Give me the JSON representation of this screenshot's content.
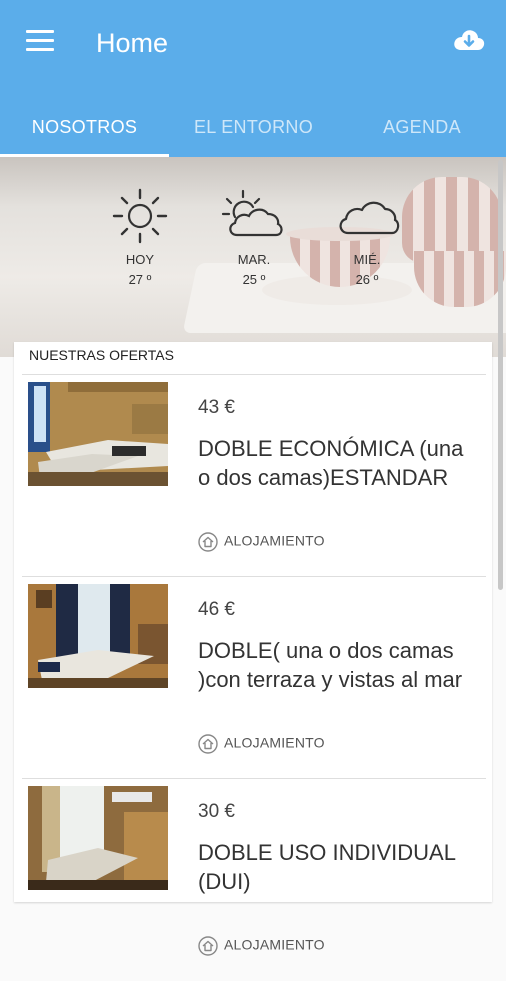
{
  "app": {
    "title": "Home"
  },
  "colors": {
    "primary": "#5badea"
  },
  "tabs": [
    {
      "label": "NOSOTROS",
      "active": true
    },
    {
      "label": "EL ENTORNO",
      "active": false
    },
    {
      "label": "AGENDA",
      "active": false
    }
  ],
  "weather": [
    {
      "day": "HOY",
      "temp": "27 º",
      "icon": "sun-icon"
    },
    {
      "day": "MAR.",
      "temp": "25 º",
      "icon": "partly-cloudy-icon"
    },
    {
      "day": "MIÉ.",
      "temp": "26 º",
      "icon": "cloud-icon"
    }
  ],
  "offers": {
    "heading": "NUESTRAS OFERTAS",
    "items": [
      {
        "price": "43 €",
        "name": "DOBLE ECONÓMICA (una o dos camas)ESTANDAR",
        "category": "ALOJAMIENTO"
      },
      {
        "price": "46 €",
        "name": "DOBLE( una o dos camas )con terraza y vistas al mar",
        "category": "ALOJAMIENTO"
      },
      {
        "price": "30 €",
        "name": "DOBLE USO INDIVIDUAL (DUI)",
        "category": "ALOJAMIENTO"
      }
    ]
  }
}
